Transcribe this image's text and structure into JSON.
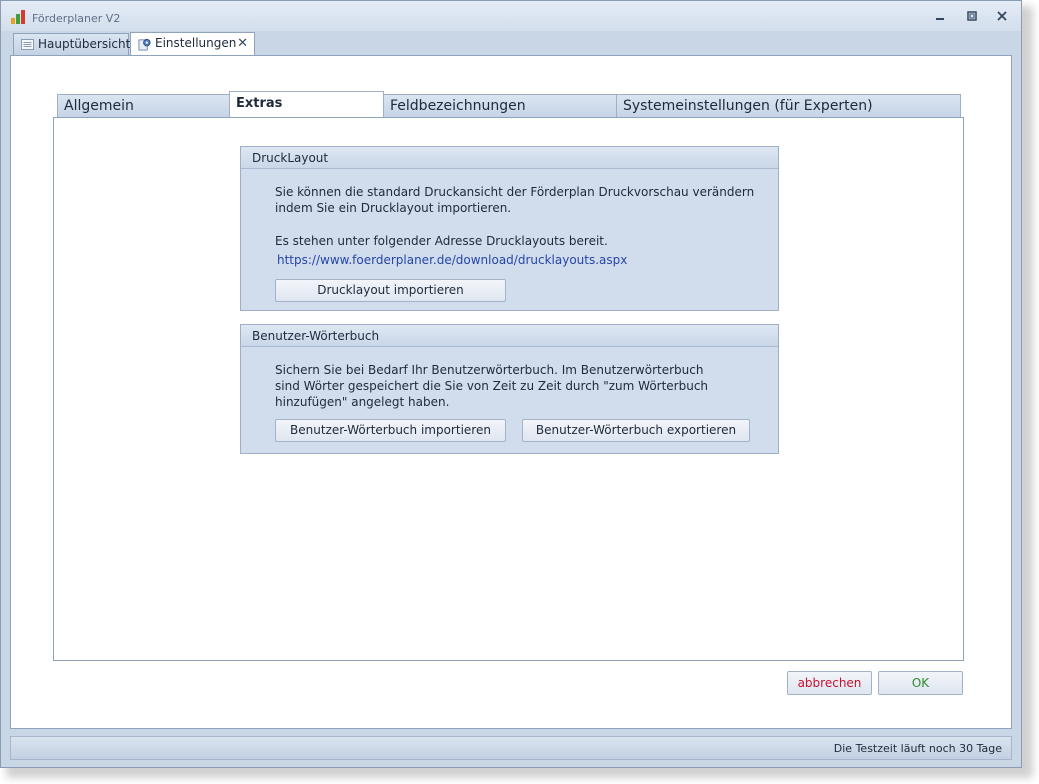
{
  "window": {
    "title": "Förderplaner V2"
  },
  "doc_tabs": [
    {
      "label": "Hauptübersicht",
      "active": false
    },
    {
      "label": "Einstellungen",
      "active": true,
      "close": "✕"
    }
  ],
  "settings_tabs": [
    {
      "label": "Allgemein",
      "active": false
    },
    {
      "label": "Extras",
      "active": true
    },
    {
      "label": "Feldbezeichnungen",
      "active": false
    },
    {
      "label": "Systemeinstellungen (für Experten)",
      "active": false
    }
  ],
  "druck_group": {
    "title": "DruckLayout",
    "text_line1": "Sie können die standard Druckansicht der Förderplan Druckvorschau verändern",
    "text_line2": "indem Sie ein Drucklayout importieren.",
    "text_line3": "Es stehen unter folgender Adresse Drucklayouts bereit.",
    "link": "https://www.foerderplaner.de/download/drucklayouts.aspx",
    "import_button": "Drucklayout importieren"
  },
  "woerterbuch_group": {
    "title": "Benutzer-Wörterbuch",
    "text_line1": "Sichern Sie bei Bedarf Ihr Benutzerwörterbuch. Im Benutzerwörterbuch",
    "text_line2": "sind Wörter gespeichert die Sie von Zeit zu Zeit durch \"zum Wörterbuch",
    "text_line3": "hinzufügen\" angelegt haben.",
    "import_button": "Benutzer-Wörterbuch importieren",
    "export_button": "Benutzer-Wörterbuch exportieren"
  },
  "dialog_buttons": {
    "cancel": "abbrechen",
    "ok": "OK"
  },
  "status": {
    "text": "Die Testzeit läuft noch 30 Tage"
  },
  "colors": {
    "cancel_text": "#c8102e",
    "ok_text": "#2e8b2e",
    "link": "#2546a8",
    "group_bg": "#d1dcec"
  },
  "icons": {
    "app": "bar-chart-icon",
    "overview_tab": "list-icon",
    "settings_tab": "settings-icon"
  }
}
